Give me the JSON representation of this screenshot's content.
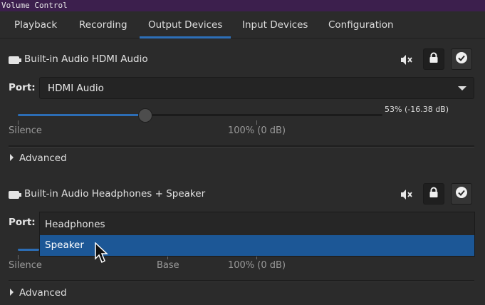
{
  "window": {
    "title": "Volume Control"
  },
  "tabs": [
    {
      "label": "Playback"
    },
    {
      "label": "Recording"
    },
    {
      "label": "Output Devices"
    },
    {
      "label": "Input Devices"
    },
    {
      "label": "Configuration"
    }
  ],
  "active_tab": "Output Devices",
  "devices": [
    {
      "name": "Built-in Audio HDMI Audio",
      "port_label": "Port:",
      "port_value": "HDMI Audio",
      "volume_text": "53% (-16.38 dB)",
      "volume_fraction": 0.53,
      "scale": {
        "silence": "Silence",
        "hundred": "100% (0 dB)"
      },
      "advanced": "Advanced"
    },
    {
      "name": "Built-in Audio Headphones + Speaker",
      "port_label": "Port:",
      "port_value": "Headphones",
      "scale": {
        "silence": "Silence",
        "base": "Base",
        "hundred": "100% (0 dB)"
      },
      "advanced": "Advanced",
      "port_options": [
        "Headphones",
        "Speaker"
      ],
      "highlighted_option": "Speaker"
    }
  ],
  "icons": {
    "device": "audio-card-icon",
    "mute": "speaker-muted-icon",
    "lock": "lock-icon",
    "default": "checkmark-icon"
  },
  "colors": {
    "accent": "#2d6fb8",
    "titlebar": "#3c1f4d",
    "selection": "#1c5796",
    "background": "#2b2b2b"
  }
}
